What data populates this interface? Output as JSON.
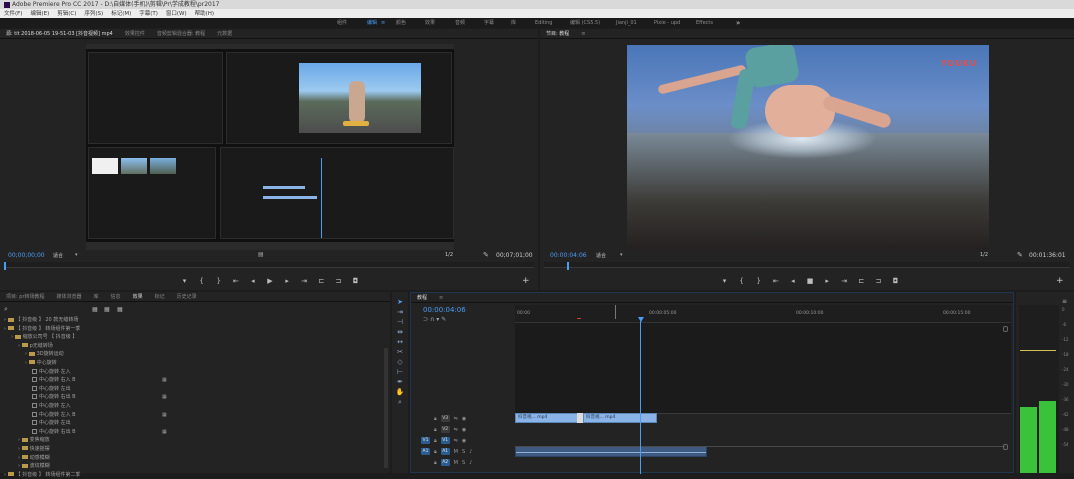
{
  "titlebar": {
    "text": "Adobe Premiere Pro CC 2017 - D:\\自媒体(手机)\\剪辑\\Pr\\学成教程\\pr2017"
  },
  "menubar": {
    "items": [
      "文件(F)",
      "编辑(E)",
      "剪辑(C)",
      "序列(S)",
      "标记(M)",
      "字幕(T)",
      "窗口(W)",
      "帮助(H)"
    ]
  },
  "workspaces": {
    "items": [
      "组件",
      "编辑",
      "颜色",
      "效果",
      "音频",
      "字幕",
      "库",
      "Editing",
      "编辑 (CS5.5)",
      "Jianji_01",
      "Pixie - upd",
      "Effects"
    ],
    "active_index": 1,
    "more": "»"
  },
  "source_monitor": {
    "tabs": [
      "源: tit 2018-06-05 19-51-03 [抖音视频] mp4",
      "效果控件",
      "音频剪辑混合器: 教程",
      "元数据"
    ],
    "timecode_in": "00;00;00;00",
    "fit": "适合",
    "fraction": "1/2",
    "duration": "00;07;01;00"
  },
  "program_monitor": {
    "tabs": [
      "节目: 教程"
    ],
    "timecode": "00:00:04:06",
    "fit": "适合",
    "fraction": "1/2",
    "duration": "00:01:36:01",
    "watermark": "YOUKU"
  },
  "transport": {
    "buttons": [
      "marker",
      "in",
      "out",
      "go-in",
      "step-back",
      "play",
      "step-forward",
      "go-out",
      "insert",
      "overwrite",
      "export-frame"
    ]
  },
  "project_panel": {
    "tabs": [
      "项目: pr转场教程",
      "媒体浏览器",
      "库",
      "信息",
      "效果",
      "标记",
      "历史记录"
    ],
    "active_tab": 4,
    "tree": [
      {
        "label": "【 抖音级 】 20 款无缝转场",
        "indent": 0,
        "type": "folder"
      },
      {
        "label": "【 抖音级 】 转场组件第一季",
        "indent": 0,
        "type": "folder"
      },
      {
        "label": "缩放公司号 【 抖音级 】",
        "indent": 1,
        "type": "folder"
      },
      {
        "label": "p无缝转场",
        "indent": 2,
        "type": "folder"
      },
      {
        "label": "3D旋转运动",
        "indent": 3,
        "type": "folder"
      },
      {
        "label": "中心旋转",
        "indent": 3,
        "type": "folder"
      },
      {
        "label": "中心旋转 左入",
        "indent": 4,
        "type": "preset"
      },
      {
        "label": "中心旋转 右入 B",
        "indent": 4,
        "type": "preset",
        "badge": true
      },
      {
        "label": "中心旋转 左出",
        "indent": 4,
        "type": "preset"
      },
      {
        "label": "中心旋转 右出 B",
        "indent": 4,
        "type": "preset",
        "badge": true
      },
      {
        "label": "中心旋转 左入",
        "indent": 4,
        "type": "preset"
      },
      {
        "label": "中心旋转 左入 B",
        "indent": 4,
        "type": "preset",
        "badge": true
      },
      {
        "label": "中心旋转 左出",
        "indent": 4,
        "type": "preset"
      },
      {
        "label": "中心旋转 右出 B",
        "indent": 4,
        "type": "preset",
        "badge": true
      },
      {
        "label": "变焦缩放",
        "indent": 2,
        "type": "folder"
      },
      {
        "label": "快速摇摆",
        "indent": 2,
        "type": "folder"
      },
      {
        "label": "动感模糊",
        "indent": 2,
        "type": "folder"
      },
      {
        "label": "波纹模糊",
        "indent": 2,
        "type": "folder"
      },
      {
        "label": "【 抖音级 】 转场组件第二季",
        "indent": 0,
        "type": "folder"
      }
    ]
  },
  "timeline": {
    "tab": "教程",
    "timecode": "00:00:04:06",
    "ruler_labels": [
      "00:00",
      "00:00:05:00",
      "00:00:10:00",
      "00:00:15:00"
    ],
    "video_tracks": [
      {
        "name": "V3"
      },
      {
        "name": "V2"
      },
      {
        "name": "V1",
        "target": "V1"
      }
    ],
    "audio_tracks": [
      {
        "name": "A1",
        "target": "A1",
        "m": "M",
        "s": "S"
      },
      {
        "name": "A2",
        "m": "M",
        "s": "S"
      }
    ],
    "clips": [
      {
        "label": "抖音视... mp4",
        "track": "V2"
      },
      {
        "label": "抖音视... mp4",
        "track": "V2"
      }
    ]
  },
  "audio_meter": {
    "scale": [
      "0",
      "-6",
      "-12",
      "-18",
      "-24",
      "-30",
      "-36",
      "-42",
      "-48",
      "-54"
    ],
    "levels": [
      0.39,
      0.43
    ],
    "colors": {
      "green": "#3ac23a",
      "peak": "#d4c05a"
    }
  },
  "colors": {
    "accent": "#4b9cf5",
    "clip_video": "#8ab4e8",
    "clip_audio": "#3e5a80",
    "playhead": "#4b9cf5"
  }
}
